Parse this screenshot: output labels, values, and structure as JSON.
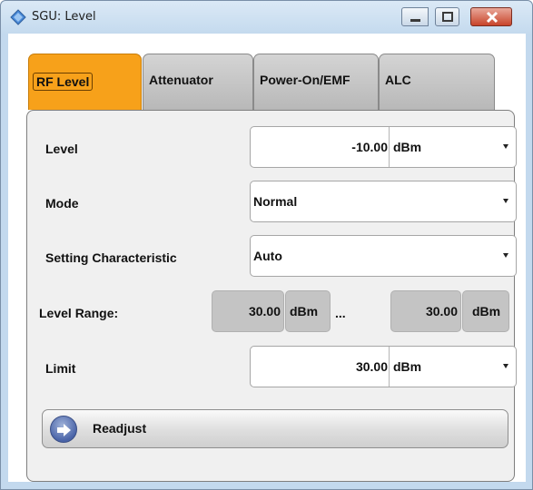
{
  "window": {
    "title": "SGU: Level",
    "icon": "diamond-app-icon",
    "controls": {
      "minimize": "minimize-icon",
      "maximize": "maximize-icon",
      "close": "close-icon"
    }
  },
  "tabs": [
    {
      "label": "RF Level",
      "active": true
    },
    {
      "label": "Attenuator",
      "active": false
    },
    {
      "label": "Power-On/EMF",
      "active": false
    },
    {
      "label": "ALC",
      "active": false
    }
  ],
  "form": {
    "level": {
      "label": "Level",
      "value": "-10.00",
      "unit": "dBm"
    },
    "mode": {
      "label": "Mode",
      "value": "Normal"
    },
    "setting": {
      "label": "Setting Characteristic",
      "value": "Auto"
    },
    "level_range": {
      "label": "Level Range:",
      "min_value": "30.00",
      "min_unit": "dBm",
      "separator": "...",
      "max_value": "30.00",
      "max_unit": "dBm"
    },
    "limit": {
      "label": "Limit",
      "value": "30.00",
      "unit": "dBm"
    }
  },
  "readjust": {
    "label": "Readjust",
    "icon": "arrow-right-circle-icon"
  },
  "colors": {
    "active_tab": "#f7a11a",
    "inactive_tab": "#c4c4c4",
    "panel": "#f0f0f0",
    "title_bar": "#c4daee",
    "close_button": "#c8442a"
  }
}
